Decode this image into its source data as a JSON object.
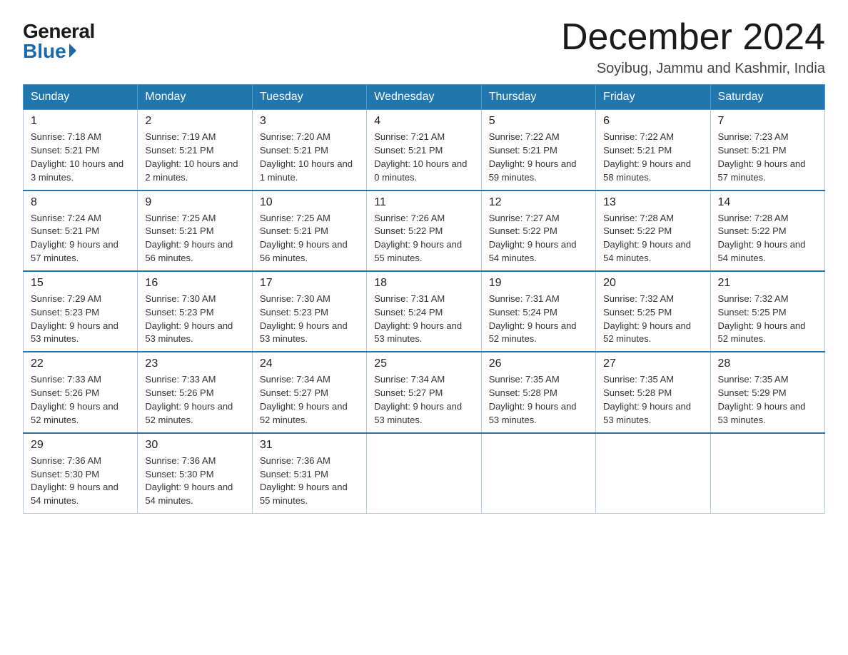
{
  "header": {
    "logo_general": "General",
    "logo_blue": "Blue",
    "month_title": "December 2024",
    "location": "Soyibug, Jammu and Kashmir, India"
  },
  "weekdays": [
    "Sunday",
    "Monday",
    "Tuesday",
    "Wednesday",
    "Thursday",
    "Friday",
    "Saturday"
  ],
  "weeks": [
    [
      {
        "day": "1",
        "sunrise": "7:18 AM",
        "sunset": "5:21 PM",
        "daylight": "10 hours and 3 minutes."
      },
      {
        "day": "2",
        "sunrise": "7:19 AM",
        "sunset": "5:21 PM",
        "daylight": "10 hours and 2 minutes."
      },
      {
        "day": "3",
        "sunrise": "7:20 AM",
        "sunset": "5:21 PM",
        "daylight": "10 hours and 1 minute."
      },
      {
        "day": "4",
        "sunrise": "7:21 AM",
        "sunset": "5:21 PM",
        "daylight": "10 hours and 0 minutes."
      },
      {
        "day": "5",
        "sunrise": "7:22 AM",
        "sunset": "5:21 PM",
        "daylight": "9 hours and 59 minutes."
      },
      {
        "day": "6",
        "sunrise": "7:22 AM",
        "sunset": "5:21 PM",
        "daylight": "9 hours and 58 minutes."
      },
      {
        "day": "7",
        "sunrise": "7:23 AM",
        "sunset": "5:21 PM",
        "daylight": "9 hours and 57 minutes."
      }
    ],
    [
      {
        "day": "8",
        "sunrise": "7:24 AM",
        "sunset": "5:21 PM",
        "daylight": "9 hours and 57 minutes."
      },
      {
        "day": "9",
        "sunrise": "7:25 AM",
        "sunset": "5:21 PM",
        "daylight": "9 hours and 56 minutes."
      },
      {
        "day": "10",
        "sunrise": "7:25 AM",
        "sunset": "5:21 PM",
        "daylight": "9 hours and 56 minutes."
      },
      {
        "day": "11",
        "sunrise": "7:26 AM",
        "sunset": "5:22 PM",
        "daylight": "9 hours and 55 minutes."
      },
      {
        "day": "12",
        "sunrise": "7:27 AM",
        "sunset": "5:22 PM",
        "daylight": "9 hours and 54 minutes."
      },
      {
        "day": "13",
        "sunrise": "7:28 AM",
        "sunset": "5:22 PM",
        "daylight": "9 hours and 54 minutes."
      },
      {
        "day": "14",
        "sunrise": "7:28 AM",
        "sunset": "5:22 PM",
        "daylight": "9 hours and 54 minutes."
      }
    ],
    [
      {
        "day": "15",
        "sunrise": "7:29 AM",
        "sunset": "5:23 PM",
        "daylight": "9 hours and 53 minutes."
      },
      {
        "day": "16",
        "sunrise": "7:30 AM",
        "sunset": "5:23 PM",
        "daylight": "9 hours and 53 minutes."
      },
      {
        "day": "17",
        "sunrise": "7:30 AM",
        "sunset": "5:23 PM",
        "daylight": "9 hours and 53 minutes."
      },
      {
        "day": "18",
        "sunrise": "7:31 AM",
        "sunset": "5:24 PM",
        "daylight": "9 hours and 53 minutes."
      },
      {
        "day": "19",
        "sunrise": "7:31 AM",
        "sunset": "5:24 PM",
        "daylight": "9 hours and 52 minutes."
      },
      {
        "day": "20",
        "sunrise": "7:32 AM",
        "sunset": "5:25 PM",
        "daylight": "9 hours and 52 minutes."
      },
      {
        "day": "21",
        "sunrise": "7:32 AM",
        "sunset": "5:25 PM",
        "daylight": "9 hours and 52 minutes."
      }
    ],
    [
      {
        "day": "22",
        "sunrise": "7:33 AM",
        "sunset": "5:26 PM",
        "daylight": "9 hours and 52 minutes."
      },
      {
        "day": "23",
        "sunrise": "7:33 AM",
        "sunset": "5:26 PM",
        "daylight": "9 hours and 52 minutes."
      },
      {
        "day": "24",
        "sunrise": "7:34 AM",
        "sunset": "5:27 PM",
        "daylight": "9 hours and 52 minutes."
      },
      {
        "day": "25",
        "sunrise": "7:34 AM",
        "sunset": "5:27 PM",
        "daylight": "9 hours and 53 minutes."
      },
      {
        "day": "26",
        "sunrise": "7:35 AM",
        "sunset": "5:28 PM",
        "daylight": "9 hours and 53 minutes."
      },
      {
        "day": "27",
        "sunrise": "7:35 AM",
        "sunset": "5:28 PM",
        "daylight": "9 hours and 53 minutes."
      },
      {
        "day": "28",
        "sunrise": "7:35 AM",
        "sunset": "5:29 PM",
        "daylight": "9 hours and 53 minutes."
      }
    ],
    [
      {
        "day": "29",
        "sunrise": "7:36 AM",
        "sunset": "5:30 PM",
        "daylight": "9 hours and 54 minutes."
      },
      {
        "day": "30",
        "sunrise": "7:36 AM",
        "sunset": "5:30 PM",
        "daylight": "9 hours and 54 minutes."
      },
      {
        "day": "31",
        "sunrise": "7:36 AM",
        "sunset": "5:31 PM",
        "daylight": "9 hours and 55 minutes."
      },
      null,
      null,
      null,
      null
    ]
  ]
}
